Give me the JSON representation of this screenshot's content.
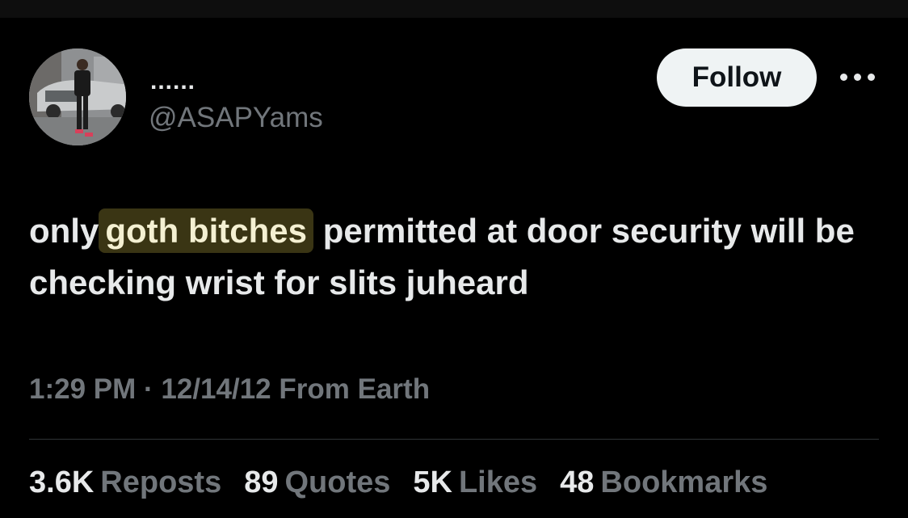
{
  "author": {
    "display_name": "......",
    "handle": "@ASAPYams"
  },
  "follow_label": "Follow",
  "more_icon": "more-dots-icon",
  "tweet": {
    "text_before": "only",
    "text_highlight": "goth bitches",
    "text_after": "permitted at door security will be checking wrist for slits juheard",
    "highlight_color": "#3a3514"
  },
  "meta": {
    "time": "1:29 PM",
    "separator": "·",
    "date": "12/14/12",
    "source": "From Earth"
  },
  "stats": [
    {
      "value": "3.6K",
      "label": "Reposts"
    },
    {
      "value": "89",
      "label": "Quotes"
    },
    {
      "value": "5K",
      "label": "Likes"
    },
    {
      "value": "48",
      "label": "Bookmarks"
    }
  ]
}
